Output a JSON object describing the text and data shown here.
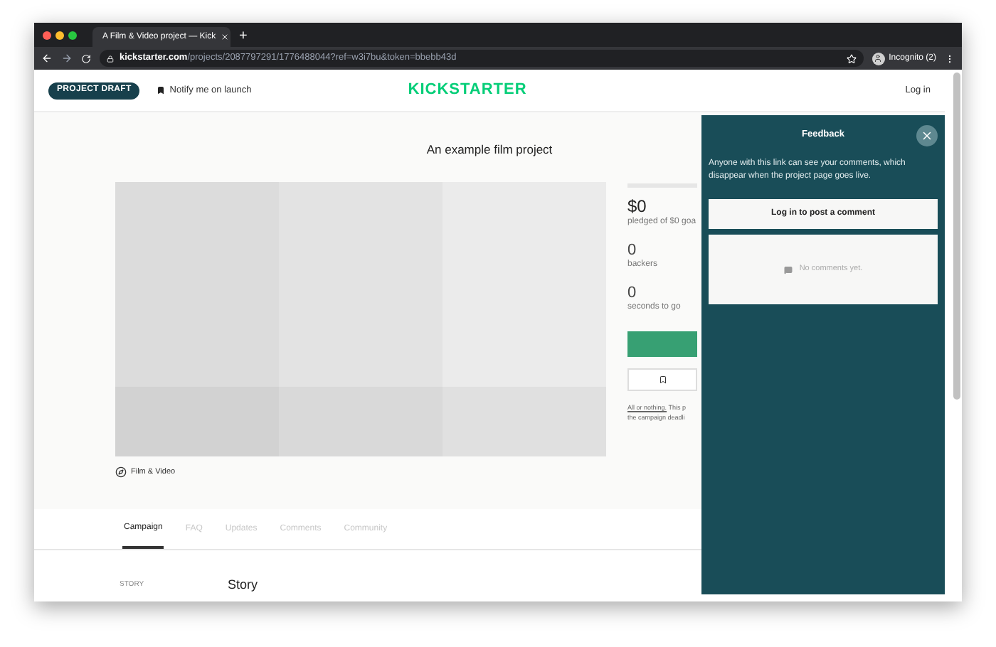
{
  "browser": {
    "tab_title": "A Film & Video project — Kick",
    "new_tab": "+",
    "url_domain": "kickstarter.com",
    "url_path": "/projects/2087797291/1776488044?ref=w3i7bu&token=bbebb43d",
    "profile": "Incognito (2)"
  },
  "header": {
    "badge": "PROJECT DRAFT",
    "notify": "Notify me on launch",
    "logo": "KICKSTARTER",
    "login": "Log in"
  },
  "project": {
    "title": "An example film project",
    "category": "Film & Video",
    "progress": {
      "level": 0
    },
    "stats": [
      {
        "value": "$0",
        "label": "pledged of $0 goa"
      },
      {
        "value": "0",
        "label": "backers"
      },
      {
        "value": "0",
        "label": "seconds to go"
      }
    ],
    "note_link": "All or nothing.",
    "note": "This p",
    "note_line2": "the campaign deadli"
  },
  "tabs": [
    {
      "label": "Campaign",
      "selected": true
    },
    {
      "label": "FAQ",
      "selected": false
    },
    {
      "label": "Updates",
      "selected": false
    },
    {
      "label": "Comments",
      "selected": false
    },
    {
      "label": "Community",
      "selected": false
    }
  ],
  "story": {
    "nav_label": "STORY",
    "heading": "Story"
  },
  "feedback": {
    "title": "Feedback",
    "description": "Anyone with this link can see your comments, which disappear when the project page goes live.",
    "login_button": "Log in to post a comment",
    "empty": "No comments yet."
  }
}
